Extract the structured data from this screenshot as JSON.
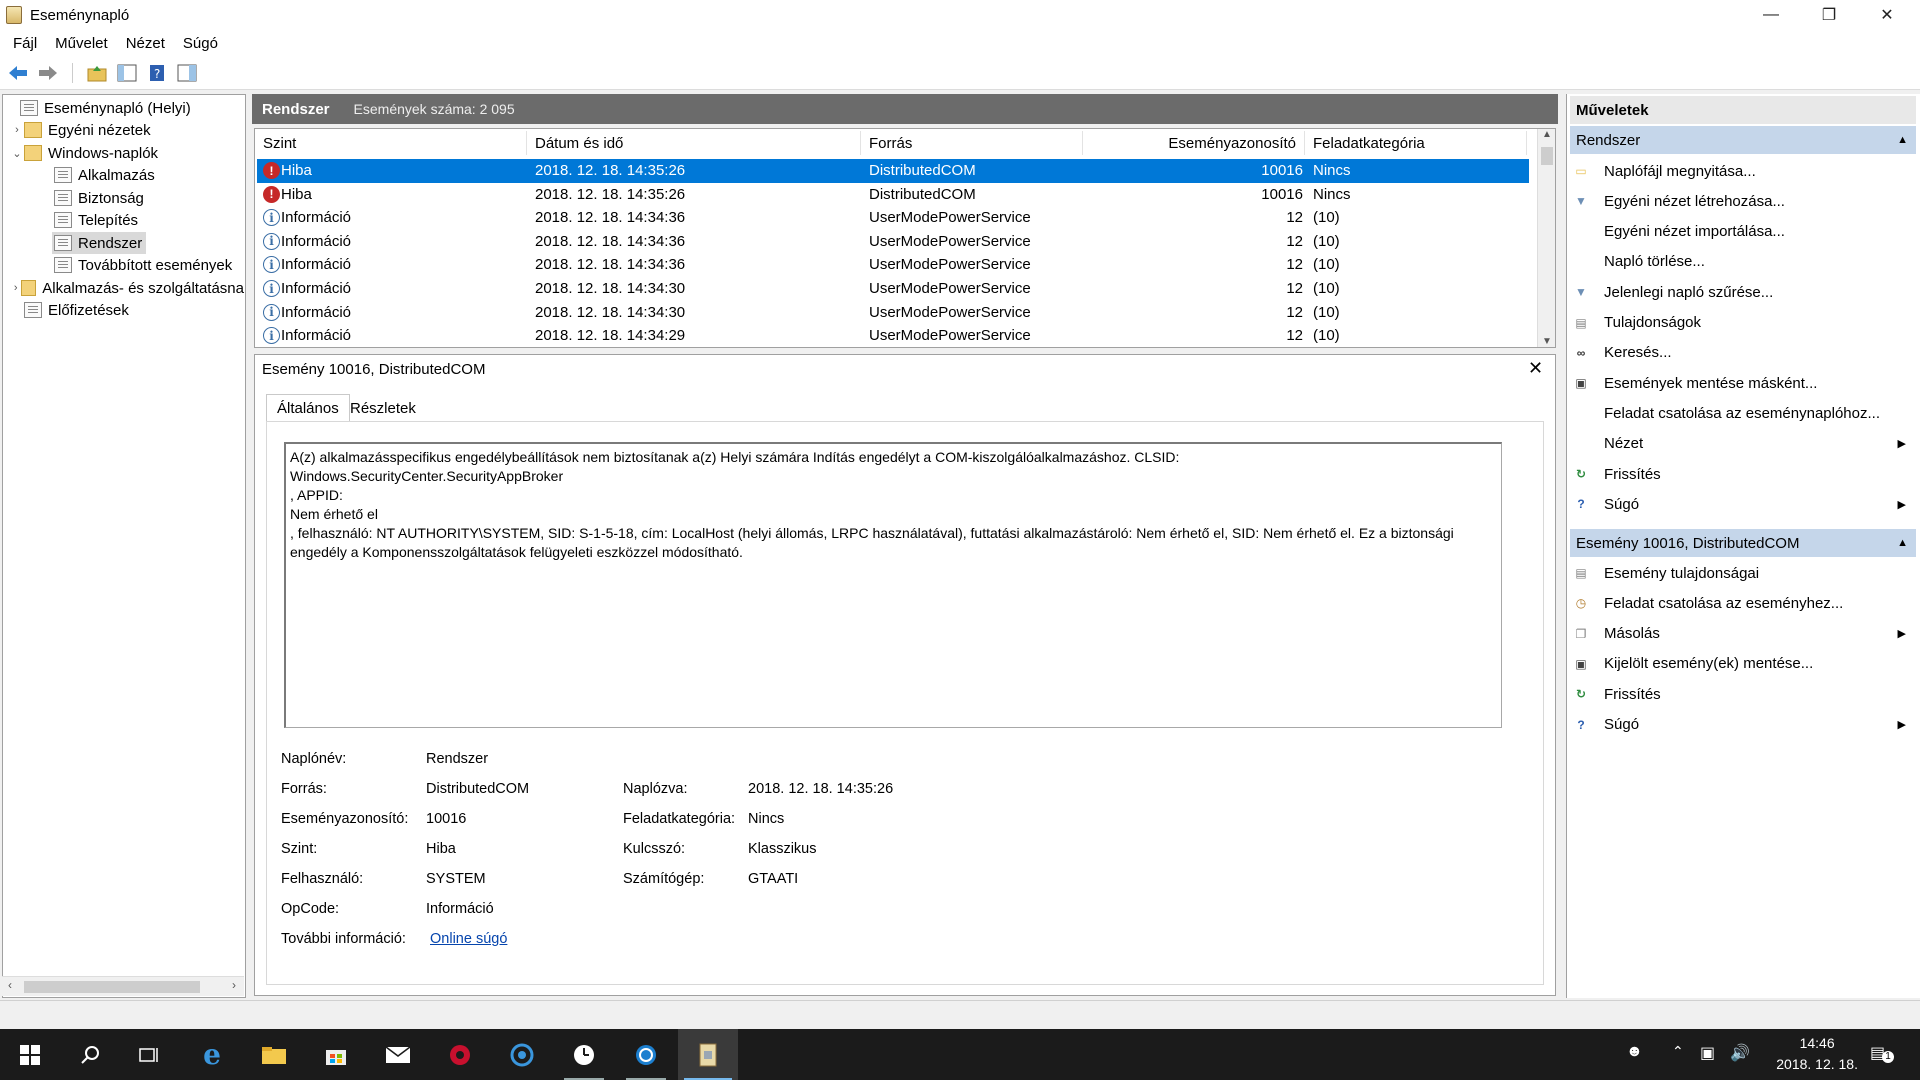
{
  "window": {
    "title": "Eseménynapló"
  },
  "menu": [
    "Fájl",
    "Művelet",
    "Nézet",
    "Súgó"
  ],
  "tree": {
    "items": [
      {
        "label": "Eseménynapló (Helyi)"
      },
      {
        "label": "Egyéni nézetek"
      },
      {
        "label": "Windows-naplók"
      },
      {
        "label": "Alkalmazás"
      },
      {
        "label": "Biztonság"
      },
      {
        "label": "Telepítés"
      },
      {
        "label": "Rendszer"
      },
      {
        "label": "Továbbított események"
      },
      {
        "label": "Alkalmazás- és szolgáltatásna"
      },
      {
        "label": "Előfizetések"
      }
    ]
  },
  "list": {
    "title": "Rendszer",
    "count_label": "Események száma: 2 095",
    "columns": [
      "Szint",
      "Dátum és idő",
      "Forrás",
      "Eseményazonosító",
      "Feladatkategória"
    ],
    "rows": [
      {
        "level": "Hiba",
        "icon": "error-icon",
        "datetime": "2018. 12. 18. 14:35:26",
        "source": "DistributedCOM",
        "id": "10016",
        "category": "Nincs"
      },
      {
        "level": "Hiba",
        "icon": "error-icon",
        "datetime": "2018. 12. 18. 14:35:26",
        "source": "DistributedCOM",
        "id": "10016",
        "category": "Nincs"
      },
      {
        "level": "Információ",
        "icon": "info-icon",
        "datetime": "2018. 12. 18. 14:34:36",
        "source": "UserModePowerService",
        "id": "12",
        "category": "(10)"
      },
      {
        "level": "Információ",
        "icon": "info-icon",
        "datetime": "2018. 12. 18. 14:34:36",
        "source": "UserModePowerService",
        "id": "12",
        "category": "(10)"
      },
      {
        "level": "Információ",
        "icon": "info-icon",
        "datetime": "2018. 12. 18. 14:34:36",
        "source": "UserModePowerService",
        "id": "12",
        "category": "(10)"
      },
      {
        "level": "Információ",
        "icon": "info-icon",
        "datetime": "2018. 12. 18. 14:34:30",
        "source": "UserModePowerService",
        "id": "12",
        "category": "(10)"
      },
      {
        "level": "Információ",
        "icon": "info-icon",
        "datetime": "2018. 12. 18. 14:34:30",
        "source": "UserModePowerService",
        "id": "12",
        "category": "(10)"
      },
      {
        "level": "Információ",
        "icon": "info-icon",
        "datetime": "2018. 12. 18. 14:34:29",
        "source": "UserModePowerService",
        "id": "12",
        "category": "(10)"
      }
    ]
  },
  "detail": {
    "title": "Esemény 10016, DistributedCOM",
    "tabs": [
      "Általános",
      "Részletek"
    ],
    "message": "A(z) alkalmazásspecifikus engedélybeállítások nem biztosítanak a(z) Helyi számára Indítás engedélyt a COM-kiszolgálóalkalmazáshoz. CLSID:\nWindows.SecurityCenter.SecurityAppBroker\n, APPID:\nNem érhető el\n, felhasználó: NT AUTHORITY\\SYSTEM, SID: S-1-5-18, cím: LocalHost (helyi állomás, LRPC használatával), futtatási alkalmazástároló: Nem érhető el, SID: Nem érhető el. Ez a biztonsági\nengedély a Komponensszolgáltatások felügyeleti eszközzel módosítható.",
    "fields": {
      "log_name_label": "Naplónév:",
      "log_name": "Rendszer",
      "source_label": "Forrás:",
      "source": "DistributedCOM",
      "logged_label": "Naplózva:",
      "logged": "2018. 12. 18. 14:35:26",
      "event_id_label": "Eseményazonosító:",
      "event_id": "10016",
      "task_label": "Feladatkategória:",
      "task": "Nincs",
      "level_label": "Szint:",
      "level": "Hiba",
      "keyword_label": "Kulcsszó:",
      "keyword": "Klasszikus",
      "user_label": "Felhasználó:",
      "user": "SYSTEM",
      "computer_label": "Számítógép:",
      "computer": "GTAATI",
      "opcode_label": "OpCode:",
      "opcode": "Információ",
      "more_info_label": "További információ:",
      "more_info": "Online súgó"
    }
  },
  "actions": {
    "header": "Műveletek",
    "section1": {
      "title": "Rendszer",
      "items": [
        {
          "label": "Naplófájl megnyitása...",
          "icon": "open-folder-icon"
        },
        {
          "label": "Egyéni nézet létrehozása...",
          "icon": "filter-icon"
        },
        {
          "label": "Egyéni nézet importálása...",
          "icon": ""
        },
        {
          "label": "Napló törlése...",
          "icon": ""
        },
        {
          "label": "Jelenlegi napló szűrése...",
          "icon": "filter-icon"
        },
        {
          "label": "Tulajdonságok",
          "icon": "properties-icon"
        },
        {
          "label": "Keresés...",
          "icon": "binoculars-icon"
        },
        {
          "label": "Események mentése másként...",
          "icon": "save-icon"
        },
        {
          "label": "Feladat csatolása az eseménynaplóhoz...",
          "icon": ""
        },
        {
          "label": "Nézet",
          "icon": "",
          "submenu": true
        },
        {
          "label": "Frissítés",
          "icon": "refresh-icon"
        },
        {
          "label": "Súgó",
          "icon": "help-icon",
          "submenu": true
        }
      ]
    },
    "section2": {
      "title": "Esemény 10016, DistributedCOM",
      "items": [
        {
          "label": "Esemény tulajdonságai",
          "icon": "properties-icon"
        },
        {
          "label": "Feladat csatolása az eseményhez...",
          "icon": "task-icon"
        },
        {
          "label": "Másolás",
          "icon": "copy-icon",
          "submenu": true
        },
        {
          "label": "Kijelölt esemény(ek) mentése...",
          "icon": "save-icon"
        },
        {
          "label": "Frissítés",
          "icon": "refresh-icon"
        },
        {
          "label": "Súgó",
          "icon": "help-icon",
          "submenu": true
        }
      ]
    }
  },
  "taskbar": {
    "time": "14:46",
    "date": "2018. 12. 18.",
    "notification_count": "1"
  },
  "colors": {
    "selection": "#0078d7",
    "section_header": "#c5d6ea",
    "error": "#c62828",
    "info": "#3a6ea5"
  }
}
